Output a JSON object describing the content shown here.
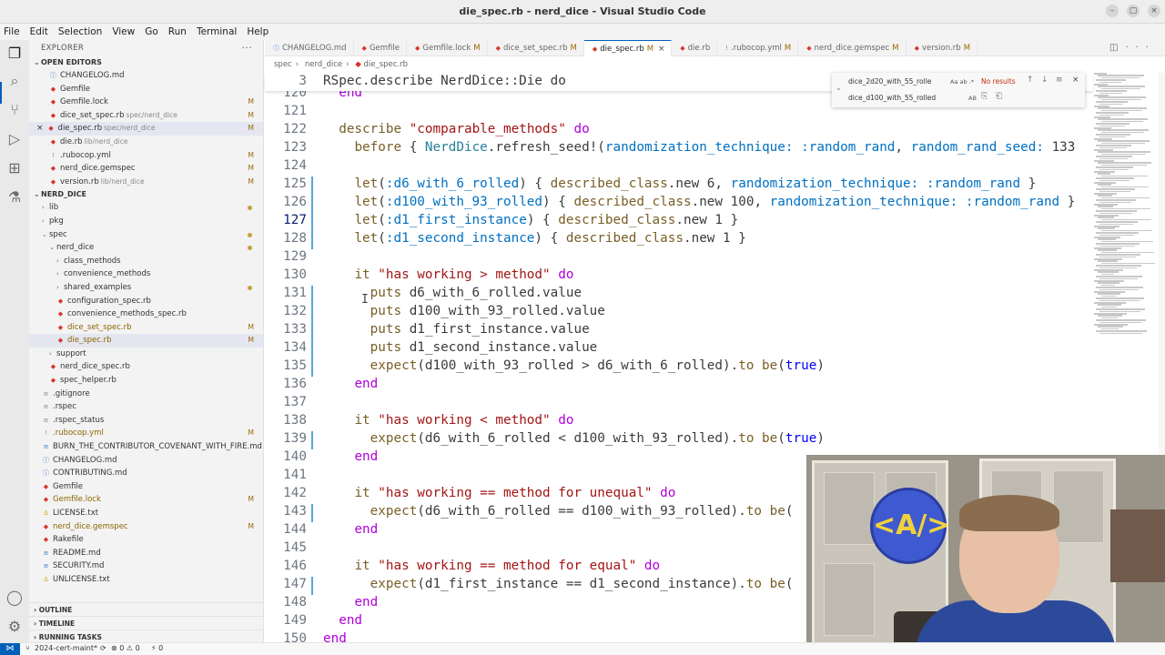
{
  "window": {
    "title": "die_spec.rb - nerd_dice - Visual Studio Code",
    "controls": [
      "–",
      "▢",
      "×"
    ]
  },
  "menu": [
    "File",
    "Edit",
    "Selection",
    "View",
    "Go",
    "Run",
    "Terminal",
    "Help"
  ],
  "sidebar": {
    "header": "EXPLORER",
    "open_editors": {
      "title": "OPEN EDITORS",
      "items": [
        {
          "name": "CHANGELOG.md",
          "icon": "info-icon",
          "badge": ""
        },
        {
          "name": "Gemfile",
          "icon": "ruby-icon",
          "badge": ""
        },
        {
          "name": "Gemfile.lock",
          "icon": "ruby-icon",
          "badge": "M"
        },
        {
          "name": "dice_set_spec.rb",
          "desc": "spec/nerd_dice",
          "icon": "ruby-icon",
          "badge": "M"
        },
        {
          "name": "die_spec.rb",
          "desc": "spec/nerd_dice",
          "icon": "ruby-icon",
          "badge": "M"
        },
        {
          "name": "die.rb",
          "desc": "lib/nerd_dice",
          "icon": "ruby-icon",
          "badge": ""
        },
        {
          "name": ".rubocop.yml",
          "icon": "yaml-icon",
          "badge": "M"
        },
        {
          "name": "nerd_dice.gemspec",
          "icon": "ruby-icon",
          "badge": "M"
        },
        {
          "name": "version.rb",
          "desc": "lib/nerd_dice",
          "icon": "ruby-icon",
          "badge": "M"
        }
      ]
    },
    "project": {
      "title": "NERD_DICE",
      "items": [
        {
          "name": "lib",
          "type": "folder",
          "depth": 1
        },
        {
          "name": "pkg",
          "type": "folder",
          "depth": 1
        },
        {
          "name": "spec",
          "type": "folder",
          "depth": 1
        },
        {
          "name": "nerd_dice",
          "type": "folder",
          "depth": 2
        },
        {
          "name": "class_methods",
          "type": "folder",
          "depth": 3
        },
        {
          "name": "convenience_methods",
          "type": "folder",
          "depth": 3
        },
        {
          "name": "shared_examples",
          "type": "folder",
          "depth": 3
        },
        {
          "name": "configuration_spec.rb",
          "type": "file",
          "depth": 3
        },
        {
          "name": "convenience_methods_spec.rb",
          "type": "file",
          "depth": 3
        },
        {
          "name": "dice_set_spec.rb",
          "type": "file",
          "depth": 3,
          "badge": "M"
        },
        {
          "name": "die_spec.rb",
          "type": "file",
          "depth": 3,
          "badge": "M"
        },
        {
          "name": "support",
          "type": "folder",
          "depth": 2
        },
        {
          "name": "nerd_dice_spec.rb",
          "type": "file",
          "depth": 2
        },
        {
          "name": "spec_helper.rb",
          "type": "file",
          "depth": 2
        },
        {
          "name": ".gitignore",
          "type": "file",
          "depth": 1
        },
        {
          "name": ".rspec",
          "type": "file",
          "depth": 1
        },
        {
          "name": ".rspec_status",
          "type": "file",
          "depth": 1
        },
        {
          "name": ".rubocop.yml",
          "type": "file",
          "depth": 1,
          "badge": "M"
        },
        {
          "name": "BURN_THE_CONTRIBUTOR_COVENANT_WITH_FIRE.md",
          "type": "file",
          "depth": 1
        },
        {
          "name": "CHANGELOG.md",
          "type": "file",
          "depth": 1
        },
        {
          "name": "CONTRIBUTING.md",
          "type": "file",
          "depth": 1
        },
        {
          "name": "Gemfile",
          "type": "file",
          "depth": 1
        },
        {
          "name": "Gemfile.lock",
          "type": "file",
          "depth": 1,
          "badge": "M"
        },
        {
          "name": "LICENSE.txt",
          "type": "file",
          "depth": 1
        },
        {
          "name": "nerd_dice.gemspec",
          "type": "file",
          "depth": 1,
          "badge": "M"
        },
        {
          "name": "Rakefile",
          "type": "file",
          "depth": 1
        },
        {
          "name": "README.md",
          "type": "file",
          "depth": 1
        },
        {
          "name": "SECURITY.md",
          "type": "file",
          "depth": 1
        },
        {
          "name": "UNLICENSE.txt",
          "type": "file",
          "depth": 1
        }
      ]
    },
    "outline": "OUTLINE",
    "timeline": "TIMELINE",
    "running_tasks": "RUNNING TASKS"
  },
  "tabs": [
    {
      "label": "CHANGELOG.md",
      "mod": ""
    },
    {
      "label": "Gemfile",
      "mod": ""
    },
    {
      "label": "Gemfile.lock",
      "mod": "M"
    },
    {
      "label": "dice_set_spec.rb",
      "mod": "M"
    },
    {
      "label": "die_spec.rb",
      "mod": "M",
      "active": true
    },
    {
      "label": "die.rb",
      "mod": ""
    },
    {
      "label": ".rubocop.yml",
      "mod": "M"
    },
    {
      "label": "nerd_dice.gemspec",
      "mod": "M"
    },
    {
      "label": "version.rb",
      "mod": "M"
    }
  ],
  "breadcrumb": [
    "spec",
    "nerd_dice",
    "die_spec.rb"
  ],
  "find": {
    "search_value": "dice_2d20_with_55_rolle",
    "replace_value": "dice_d100_with_55_rolled",
    "search_opts": "Aa ab .*",
    "replace_opts": "AB",
    "status": "No results"
  },
  "editor": {
    "sticky": {
      "line": "3",
      "text": "RSpec.describe NerdDice::Die do"
    },
    "current_line": "127",
    "lines": [
      {
        "n": "120",
        "text": "  end"
      },
      {
        "n": "121",
        "text": ""
      },
      {
        "n": "122",
        "text": "  describe \"comparable_methods\" do"
      },
      {
        "n": "123",
        "text": "    before { NerdDice.refresh_seed!(randomization_technique: :random_rand, random_rand_seed: 133"
      },
      {
        "n": "124",
        "text": ""
      },
      {
        "n": "125",
        "text": "    let(:d6_with_6_rolled) { described_class.new 6, randomization_technique: :random_rand }"
      },
      {
        "n": "126",
        "text": "    let(:d100_with_93_rolled) { described_class.new 100, randomization_technique: :random_rand }"
      },
      {
        "n": "127",
        "text": "    let(:d1_first_instance) { described_class.new 1 }"
      },
      {
        "n": "128",
        "text": "    let(:d1_second_instance) { described_class.new 1 }"
      },
      {
        "n": "129",
        "text": ""
      },
      {
        "n": "130",
        "text": "    it \"has working > method\" do"
      },
      {
        "n": "131",
        "text": "      puts d6_with_6_rolled.value"
      },
      {
        "n": "132",
        "text": "      puts d100_with_93_rolled.value"
      },
      {
        "n": "133",
        "text": "      puts d1_first_instance.value"
      },
      {
        "n": "134",
        "text": "      puts d1_second_instance.value"
      },
      {
        "n": "135",
        "text": "      expect(d100_with_93_rolled > d6_with_6_rolled).to be(true)"
      },
      {
        "n": "136",
        "text": "    end"
      },
      {
        "n": "137",
        "text": ""
      },
      {
        "n": "138",
        "text": "    it \"has working < method\" do"
      },
      {
        "n": "139",
        "text": "      expect(d6_with_6_rolled < d100_with_93_rolled).to be(true)"
      },
      {
        "n": "140",
        "text": "    end"
      },
      {
        "n": "141",
        "text": ""
      },
      {
        "n": "142",
        "text": "    it \"has working == method for unequal\" do"
      },
      {
        "n": "143",
        "text": "      expect(d6_with_6_rolled == d100_with_93_rolled).to be("
      },
      {
        "n": "144",
        "text": "    end"
      },
      {
        "n": "145",
        "text": ""
      },
      {
        "n": "146",
        "text": "    it \"has working == method for equal\" do"
      },
      {
        "n": "147",
        "text": "      expect(d1_first_instance == d1_second_instance).to be("
      },
      {
        "n": "148",
        "text": "    end"
      },
      {
        "n": "149",
        "text": "  end"
      },
      {
        "n": "150",
        "text": "end"
      }
    ]
  },
  "statusbar": {
    "branch": "2024-cert-maint*",
    "sync": "⟳",
    "problems": "⊗ 0 ⚠ 0",
    "ports": "⚡ 0"
  },
  "colors": {
    "accent": "#005fb8",
    "modified": "#9a6a00",
    "ruby": "#d8342c"
  }
}
